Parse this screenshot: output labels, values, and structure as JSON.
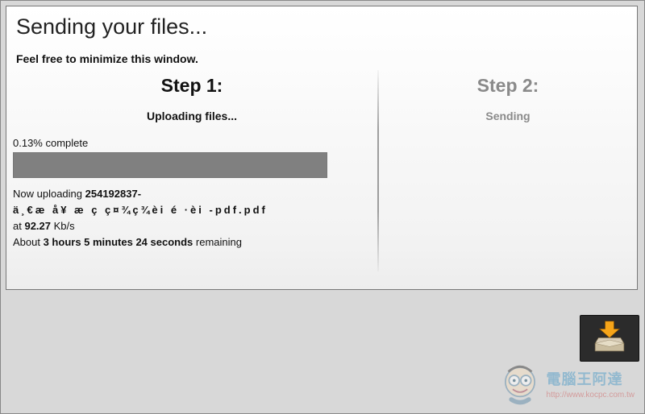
{
  "header": {
    "title": "Sending your files...",
    "subtitle": "Feel free to minimize this window."
  },
  "step1": {
    "title": "Step 1:",
    "subtitle": "Uploading files...",
    "percent_label": "0.13% complete",
    "progress_pct": 100,
    "now_uploading_prefix": "Now uploading ",
    "filename_id": "254192837-",
    "filename_rest": "ä¸€æ å¥ æ ç ç¤¾ç¾èi é ·èi -pdf.pdf",
    "rate_prefix": "at ",
    "rate_value": "92.27",
    "rate_unit": " Kb/s",
    "remaining_prefix": "About ",
    "remaining_value": "3 hours 5 minutes 24 seconds",
    "remaining_suffix": " remaining"
  },
  "step2": {
    "title": "Step 2:",
    "subtitle": "Sending"
  },
  "watermark": {
    "title": "電腦王阿達",
    "url": "http://www.kocpc.com.tw"
  }
}
